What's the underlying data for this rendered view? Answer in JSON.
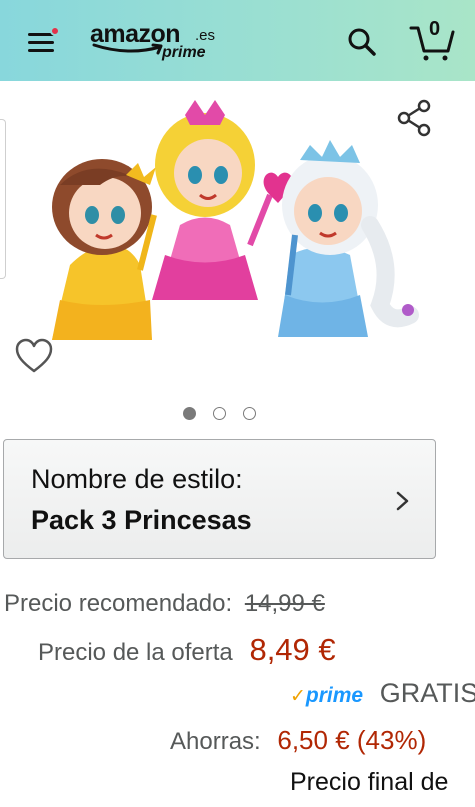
{
  "header": {
    "logo_word": "amazon",
    "logo_tld": ".es",
    "logo_prime": "prime",
    "cart_count": "0"
  },
  "colors": {
    "header_start": "#88d7dc",
    "header_end": "#a9e5c8",
    "price_red": "#b12704",
    "label_gray": "#565959",
    "prime_blue": "#1a98ff",
    "notification_dot": "#e3324a"
  },
  "icons": {
    "menu": "hamburger-menu-icon",
    "search": "search-icon",
    "cart": "cart-icon",
    "share": "share-icon",
    "favorite": "heart-icon",
    "chevron": "chevron-right-icon"
  },
  "gallery": {
    "image_count": 3,
    "active_index": 0
  },
  "style_selector": {
    "label": "Nombre de estilo:",
    "value": "Pack 3 Princesas"
  },
  "pricing": {
    "recommended_label": "Precio recomendado:",
    "recommended_value": "14,99 €",
    "offer_label": "Precio de la oferta",
    "offer_value": "8,49 €",
    "prime_label": "prime",
    "shipping_text": "GRATIS",
    "savings_label": "Ahorras:",
    "savings_value": "6,50 € (43%)",
    "final_price_text": "Precio final de"
  }
}
